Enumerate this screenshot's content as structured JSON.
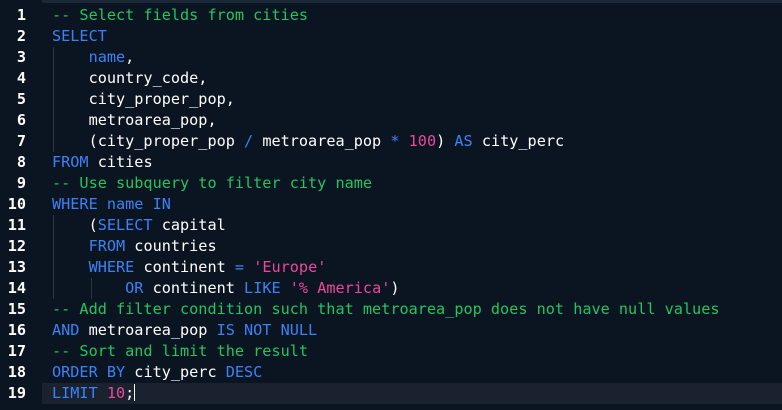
{
  "editor": {
    "language": "SQL",
    "current_line": 19,
    "lines": [
      {
        "no": "1",
        "tokens": [
          {
            "t": "-- Select fields from cities",
            "k": "comment"
          }
        ]
      },
      {
        "no": "2",
        "tokens": [
          {
            "t": "SELECT",
            "k": "kw"
          }
        ]
      },
      {
        "no": "3",
        "tokens": [
          {
            "t": "    ",
            "k": "plain"
          },
          {
            "t": "name",
            "k": "col"
          },
          {
            "t": ",",
            "k": "plain"
          }
        ]
      },
      {
        "no": "4",
        "tokens": [
          {
            "t": "    country_code,",
            "k": "plain"
          }
        ]
      },
      {
        "no": "5",
        "tokens": [
          {
            "t": "    city_proper_pop,",
            "k": "plain"
          }
        ]
      },
      {
        "no": "6",
        "tokens": [
          {
            "t": "    metroarea_pop,",
            "k": "plain"
          }
        ]
      },
      {
        "no": "7",
        "tokens": [
          {
            "t": "    (city_proper_pop ",
            "k": "plain"
          },
          {
            "t": "/",
            "k": "op"
          },
          {
            "t": " metroarea_pop ",
            "k": "plain"
          },
          {
            "t": "*",
            "k": "op"
          },
          {
            "t": " ",
            "k": "plain"
          },
          {
            "t": "100",
            "k": "num"
          },
          {
            "t": ") ",
            "k": "plain"
          },
          {
            "t": "AS",
            "k": "kw"
          },
          {
            "t": " city_perc",
            "k": "plain"
          }
        ]
      },
      {
        "no": "8",
        "tokens": [
          {
            "t": "FROM",
            "k": "kw"
          },
          {
            "t": " cities",
            "k": "plain"
          }
        ]
      },
      {
        "no": "9",
        "tokens": [
          {
            "t": "-- Use subquery to filter city name",
            "k": "comment"
          }
        ]
      },
      {
        "no": "10",
        "tokens": [
          {
            "t": "WHERE",
            "k": "kw"
          },
          {
            "t": " ",
            "k": "plain"
          },
          {
            "t": "name",
            "k": "col"
          },
          {
            "t": " ",
            "k": "plain"
          },
          {
            "t": "IN",
            "k": "kw"
          }
        ]
      },
      {
        "no": "11",
        "tokens": [
          {
            "t": "    (",
            "k": "plain"
          },
          {
            "t": "SELECT",
            "k": "kw"
          },
          {
            "t": " capital",
            "k": "plain"
          }
        ]
      },
      {
        "no": "12",
        "tokens": [
          {
            "t": "    ",
            "k": "plain"
          },
          {
            "t": "FROM",
            "k": "kw"
          },
          {
            "t": " countries",
            "k": "plain"
          }
        ]
      },
      {
        "no": "13",
        "tokens": [
          {
            "t": "    ",
            "k": "plain"
          },
          {
            "t": "WHERE",
            "k": "kw"
          },
          {
            "t": " continent ",
            "k": "plain"
          },
          {
            "t": "=",
            "k": "op"
          },
          {
            "t": " ",
            "k": "plain"
          },
          {
            "t": "'Europe'",
            "k": "str"
          }
        ]
      },
      {
        "no": "14",
        "tokens": [
          {
            "t": "        ",
            "k": "plain"
          },
          {
            "t": "OR",
            "k": "kw"
          },
          {
            "t": " continent ",
            "k": "plain"
          },
          {
            "t": "LIKE",
            "k": "kw"
          },
          {
            "t": " ",
            "k": "plain"
          },
          {
            "t": "'% America'",
            "k": "str"
          },
          {
            "t": ")",
            "k": "plain"
          }
        ]
      },
      {
        "no": "15",
        "tokens": [
          {
            "t": "-- Add filter condition such that metroarea_pop does not have null values",
            "k": "comment"
          }
        ]
      },
      {
        "no": "16",
        "tokens": [
          {
            "t": "AND",
            "k": "kw"
          },
          {
            "t": " metroarea_pop ",
            "k": "plain"
          },
          {
            "t": "IS NOT NULL",
            "k": "kw"
          }
        ]
      },
      {
        "no": "17",
        "tokens": [
          {
            "t": "-- Sort and limit the result",
            "k": "comment"
          }
        ]
      },
      {
        "no": "18",
        "tokens": [
          {
            "t": "ORDER BY",
            "k": "kw"
          },
          {
            "t": " city_perc ",
            "k": "plain"
          },
          {
            "t": "DESC",
            "k": "kw"
          }
        ]
      },
      {
        "no": "19",
        "tokens": [
          {
            "t": "LIMIT",
            "k": "kw"
          },
          {
            "t": " ",
            "k": "plain"
          },
          {
            "t": "10",
            "k": "num"
          },
          {
            "t": ";",
            "k": "plain"
          }
        ]
      }
    ]
  }
}
